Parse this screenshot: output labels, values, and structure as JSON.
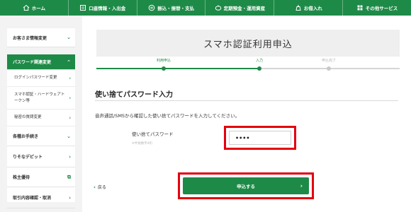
{
  "nav": {
    "items": [
      {
        "label": "ホーム",
        "icon": "home-icon"
      },
      {
        "label": "口座情報・入出金",
        "icon": "bankbook-icon"
      },
      {
        "label": "振込・振替・支払",
        "icon": "transfer-icon"
      },
      {
        "label": "定期預金・運用資産",
        "icon": "piggy-bank-icon"
      },
      {
        "label": "お借入れ",
        "icon": "loan-icon"
      },
      {
        "label": "その他サービス",
        "icon": "menu-grid-icon"
      }
    ]
  },
  "sidebar": {
    "items": [
      {
        "label": "お客さま情報変更"
      },
      {
        "label": "パスワード関連変更"
      },
      {
        "label": "ログインパスワード変更"
      },
      {
        "label": "スマホ認証・ハードウェアトークン等"
      },
      {
        "label": "秘密の質問変更"
      },
      {
        "label": "各種お手続き"
      },
      {
        "label": "りそなデビット"
      },
      {
        "label": "株主優待"
      },
      {
        "label": "取引内容確認・取消"
      }
    ]
  },
  "main": {
    "title": "スマホ認証利用申込",
    "steps": [
      {
        "label": "利用申込",
        "state": "done"
      },
      {
        "label": "入力",
        "state": "current"
      },
      {
        "label": "申込完了",
        "state": "todo"
      }
    ],
    "section_heading": "使い捨てパスワード入力",
    "instruction": "音声通話/SMSから確認した使い捨てパスワードを入力してください。",
    "password": {
      "label": "使い捨てパスワード",
      "hint": "※半角数字4桁",
      "value": "••••"
    },
    "back_label": "戻る",
    "submit_label": "申込する"
  },
  "colors": {
    "brand_green": "#1e8a47",
    "highlight_red": "#e4000f"
  }
}
